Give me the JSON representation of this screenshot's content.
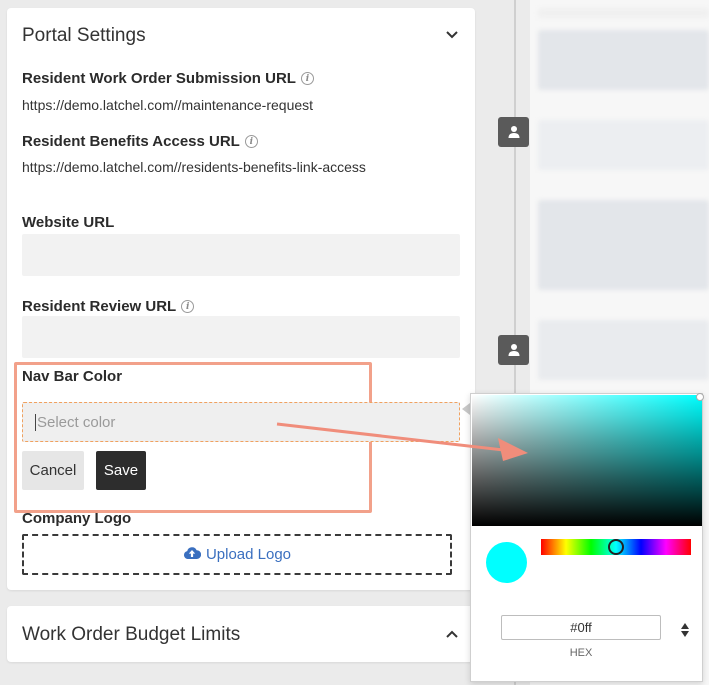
{
  "portal_settings": {
    "title": "Portal Settings",
    "work_order_url": {
      "label": "Resident Work Order Submission URL",
      "value": "https://demo.latchel.com//maintenance-request"
    },
    "benefits_url": {
      "label": "Resident Benefits Access URL",
      "value": "https://demo.latchel.com//residents-benefits-link-access"
    },
    "website_url": {
      "label": "Website URL",
      "value": ""
    },
    "review_url": {
      "label": "Resident Review URL",
      "value": ""
    },
    "nav_bar_color": {
      "label": "Nav Bar Color",
      "placeholder": "Select color",
      "cancel_label": "Cancel",
      "save_label": "Save"
    },
    "company_logo": {
      "label": "Company Logo",
      "upload_label": "Upload Logo"
    }
  },
  "budget_limits": {
    "title": "Work Order Budget Limits"
  },
  "color_picker": {
    "hex_value": "#0ff",
    "mode_label": "HEX",
    "current_color": "#00ffff",
    "hue_fraction": 0.5
  },
  "icons": {
    "info": "info-circle-icon",
    "chevron_down": "chevron-down-icon",
    "chevron_up": "chevron-up-icon",
    "upload": "cloud-upload-icon",
    "user": "user-icon"
  },
  "colors": {
    "highlight_border": "#f2a18a",
    "annotation_arrow": "#f08d7b",
    "save_button": "#2d2d2d",
    "upload_text": "#3a6fbf"
  }
}
